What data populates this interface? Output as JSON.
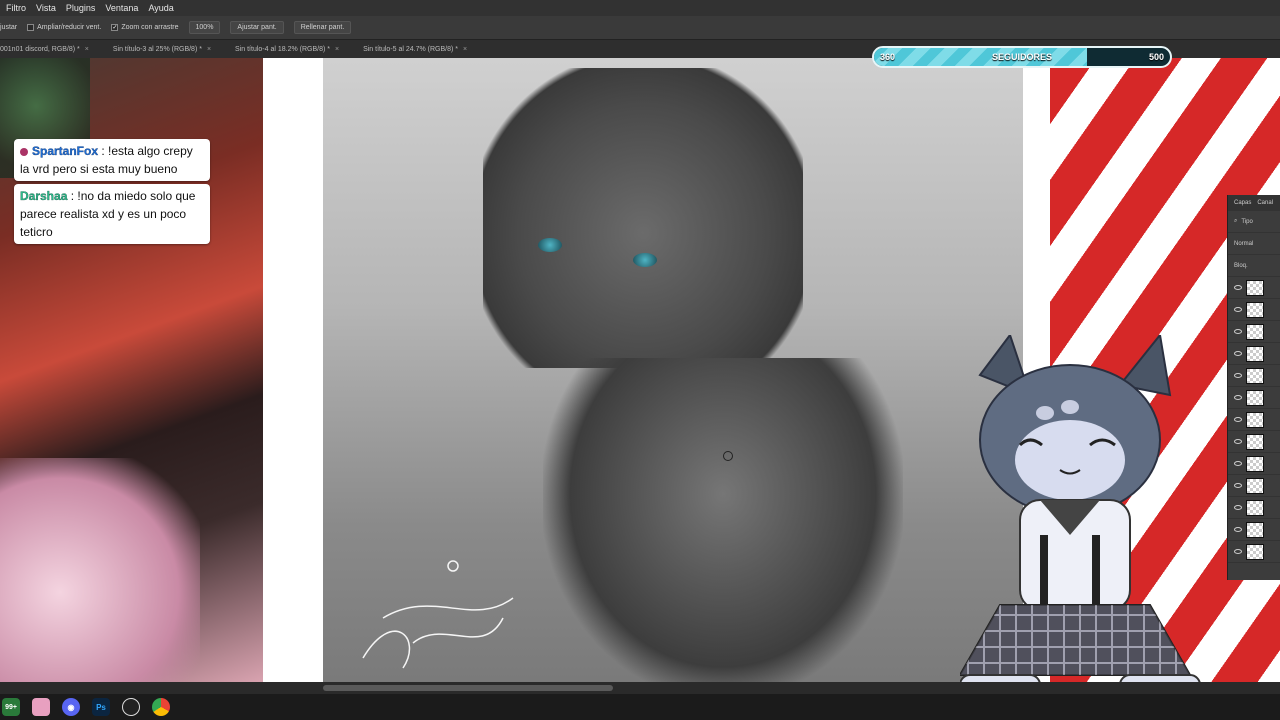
{
  "menubar": {
    "items": [
      "Filtro",
      "Vista",
      "Plugins",
      "Ventana",
      "Ayuda"
    ]
  },
  "options": {
    "partial": "justar",
    "resize_windows": "Ampliar/reducir vent.",
    "scrubby_zoom": "Zoom con arrastre",
    "zoom": "100%",
    "fit_screen": "Ajustar pant.",
    "fill_screen": "Rellenar pant."
  },
  "tabs": [
    {
      "label": "001n01 discord, RGB/8) *"
    },
    {
      "label": "Sin título-3 al 25% (RGB/8) *"
    },
    {
      "label": "Sin título-4 al 18.2% (RGB/8) *"
    },
    {
      "label": "Sin título-5 al 24.7% (RGB/8) *"
    }
  ],
  "chat": [
    {
      "user": "SpartanFox",
      "sep": " : ",
      "message": "!esta algo crepy la vrd pero si esta muy bueno"
    },
    {
      "user": "Darshaa",
      "sep": " : ",
      "message": "!no da miedo solo que parece realista xd y es un poco teticro"
    }
  ],
  "followers": {
    "current": "360",
    "label": "SEGUIDORES",
    "goal": "500",
    "progress": 0.72
  },
  "layers_panel": {
    "tab_layers": "Capas",
    "tab_channels": "Canal",
    "filter": "Tipo",
    "blend": "Normal",
    "lock": "Bloq.",
    "row_count": 13
  },
  "taskbar": {
    "badge": "99+",
    "icons": [
      "notification-icon",
      "image-app-icon",
      "discord-icon",
      "photoshop-icon",
      "obs-icon",
      "chrome-icon"
    ],
    "ps_label": "Ps"
  },
  "colors": {
    "chrome_dark": "#2b2b2b",
    "follower_fill": "#4fc7d8",
    "user1": "#1f6fd6",
    "user2": "#2dbd8d"
  }
}
